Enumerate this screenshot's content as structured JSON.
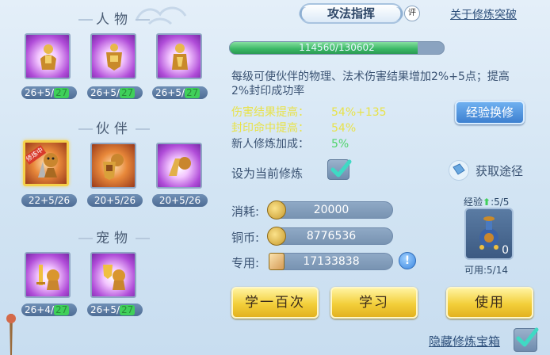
{
  "sections": {
    "characters": "人物",
    "partners": "伙伴",
    "pets": "宠物"
  },
  "character_cards": [
    {
      "name": "attack-cultivation",
      "level_main": "26+5/",
      "level_green": "27"
    },
    {
      "name": "defense-cultivation",
      "level_main": "26+5/",
      "level_green": "27"
    },
    {
      "name": "seal-resist-cultivation",
      "level_main": "26+5/",
      "level_green": "27"
    }
  ],
  "partner_cards": [
    {
      "name": "partner-attack",
      "level": "22+5/26",
      "tag": "修炼中"
    },
    {
      "name": "partner-defense",
      "level": "20+5/26"
    },
    {
      "name": "partner-seal",
      "level": "20+5/26"
    }
  ],
  "pet_cards": [
    {
      "name": "pet-attack",
      "level_main": "26+4/",
      "level_green": "27"
    },
    {
      "name": "pet-defense",
      "level_main": "26+5/",
      "level_green": "27"
    }
  ],
  "header": {
    "title": "攻法指挥",
    "rate_icon": "评",
    "about_link": "关于修炼突破"
  },
  "progress": {
    "text": "114560/130602",
    "ratio": 0.877
  },
  "description": "每级可使伙伴的物理、法术伤害结果增加2%+5点；提高2%封印成功率",
  "stats": [
    {
      "label": "伤害结果提高：",
      "value": "54%+135",
      "color": "#e8e24a"
    },
    {
      "label": "封印命中提高：",
      "value": "54%",
      "color": "#e8e24a"
    },
    {
      "label": "新人修炼加成：",
      "value": "5%",
      "color": "#4fd46a"
    }
  ],
  "exp_exchange_button": "经验换修",
  "set_current_label": "设为当前修炼",
  "set_current_checked": true,
  "get_way_label": "获取途径",
  "costs": {
    "consume_label": "消耗:",
    "consume_value": "20000",
    "copper_label": "铜币:",
    "copper_value": "8776536",
    "special_label": "专用:",
    "special_value": "17133838",
    "warn_icon": "!"
  },
  "exp_item": {
    "top_label": "经验",
    "top_value": ":5/5",
    "count": "0",
    "bottom_label": "可用:5/14"
  },
  "buttons": {
    "learn_hundred": "学一百次",
    "learn": "学习",
    "use": "使用"
  },
  "hide_label": "隐藏修炼宝箱",
  "hide_checked": true,
  "colors": {
    "accent_gold": "#f3cf3a",
    "progress_green": "#3ab765",
    "highlight_yellow": "#e8e24a",
    "bonus_green": "#4fd46a"
  }
}
